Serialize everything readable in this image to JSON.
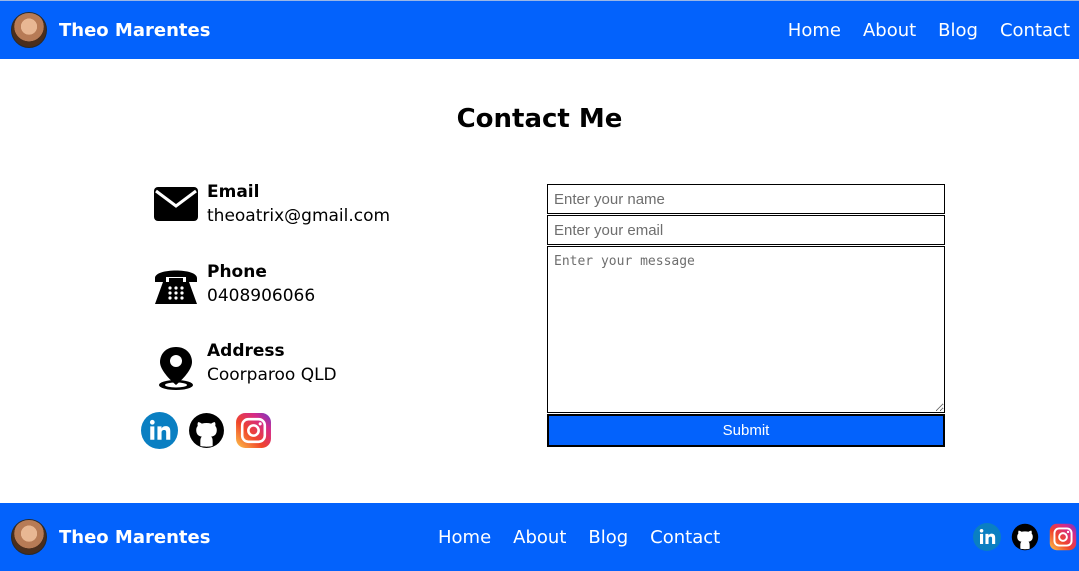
{
  "header": {
    "brand": "Theo Marentes",
    "nav": [
      "Home",
      "About",
      "Blog",
      "Contact"
    ]
  },
  "page": {
    "title": "Contact Me"
  },
  "contact_info": [
    {
      "label": "Email",
      "value": "theoatrix@gmail.com",
      "icon": "envelope-icon"
    },
    {
      "label": "Phone",
      "value": "0408906066",
      "icon": "telephone-icon"
    },
    {
      "label": "Address",
      "value": "Coorparoo QLD",
      "icon": "map-pin-icon"
    }
  ],
  "form": {
    "name_placeholder": "Enter your name",
    "email_placeholder": "Enter your email",
    "message_placeholder": "Enter your message",
    "submit_label": "Submit"
  },
  "social": [
    "linkedin-icon",
    "github-icon",
    "instagram-icon"
  ],
  "footer": {
    "brand": "Theo Marentes",
    "nav": [
      "Home",
      "About",
      "Blog",
      "Contact"
    ]
  },
  "colors": {
    "brand_blue": "#0362fc",
    "linkedin": "#0a7fc2"
  }
}
